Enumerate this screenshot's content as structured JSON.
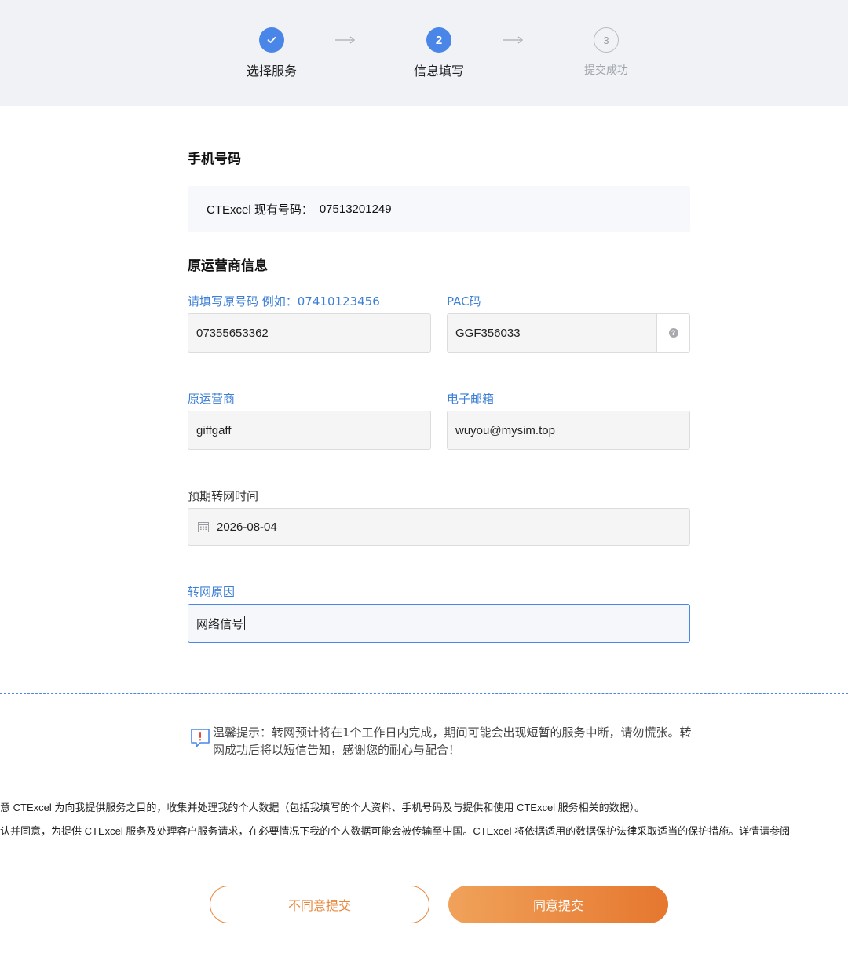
{
  "stepper": {
    "steps": [
      {
        "number": "",
        "label": "选择服务",
        "state": "done"
      },
      {
        "number": "2",
        "label": "信息填写",
        "state": "active"
      },
      {
        "number": "3",
        "label": "提交成功",
        "state": "todo"
      }
    ]
  },
  "phone_section": {
    "title": "手机号码",
    "current_label": "CTExcel 现有号码：",
    "current_number": "07513201249"
  },
  "carrier_section": {
    "title": "原运营商信息",
    "original_number": {
      "label": "请填写原号码 例如：07410123456",
      "value": "07355653362"
    },
    "pac_code": {
      "label": "PAC码",
      "value": "GGF356033"
    },
    "carrier": {
      "label": "原运营商",
      "value": "giffgaff"
    },
    "email": {
      "label": "电子邮箱",
      "value": "wuyou@mysim.top"
    },
    "transfer_date": {
      "label": "预期转网时间",
      "value": "2026-08-04"
    },
    "reason": {
      "label": "转网原因",
      "value": "网络信号"
    }
  },
  "tip": {
    "text": "温馨提示：转网预计将在1个工作日内完成，期间可能会出现短暂的服务中断，请勿慌张。转网成功后将以短信告知，感谢您的耐心与配合！"
  },
  "consent": {
    "line1": "意 CTExcel 为向我提供服务之目的，收集并处理我的个人数据（包括我填写的个人资料、手机号码及与提供和使用 CTExcel 服务相关的数据）。",
    "line2": "认并同意，为提供 CTExcel 服务及处理客户服务请求，在必要情况下我的个人数据可能会被传输至中国。CTExcel 将依据适用的数据保护法律采取适当的保护措施。详情请参阅"
  },
  "buttons": {
    "disagree": "不同意提交",
    "agree": "同意提交"
  },
  "colors": {
    "accent_blue": "#4a86e8",
    "accent_orange": "#e8873c"
  }
}
